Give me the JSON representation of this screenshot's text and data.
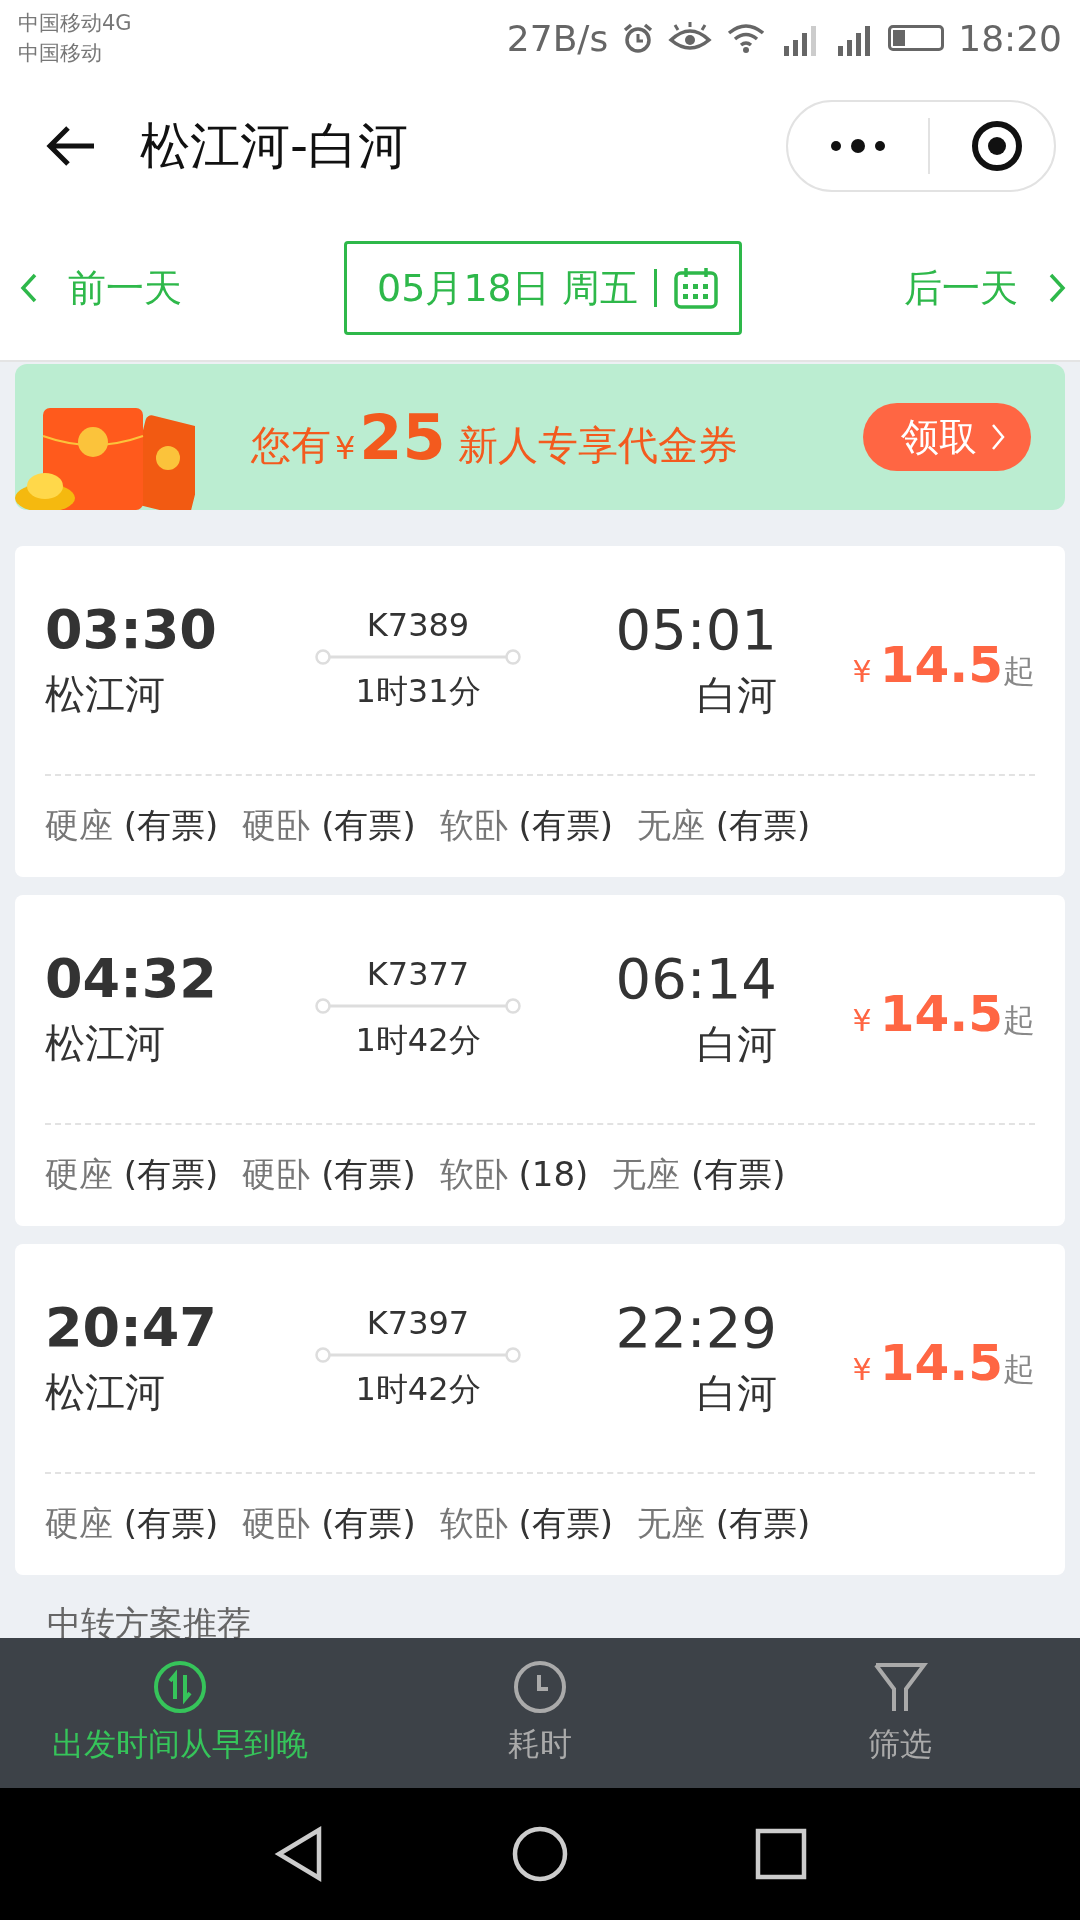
{
  "status_bar": {
    "carrier_1": "中国移动4G",
    "carrier_2": "中国移动",
    "speed": "27B/s",
    "time": "18:20"
  },
  "header": {
    "title": "松江河-白河"
  },
  "date_bar": {
    "prev": "前一天",
    "date": "05月18日 周五",
    "next": "后一天"
  },
  "banner": {
    "prefix": "您有",
    "currency": "¥",
    "amount": "25",
    "suffix": "新人专享代金券",
    "button": "领取"
  },
  "trains": [
    {
      "depart": "03:30",
      "from": "松江河",
      "number": "K7389",
      "duration": "1时31分",
      "arrive": "05:01",
      "to": "白河",
      "currency": "¥",
      "price": "14.5",
      "price_suffix": "起",
      "seats": [
        {
          "type": "硬座",
          "status": "(有票)"
        },
        {
          "type": "硬卧",
          "status": "(有票)"
        },
        {
          "type": "软卧",
          "status": "(有票)"
        },
        {
          "type": "无座",
          "status": "(有票)"
        }
      ]
    },
    {
      "depart": "04:32",
      "from": "松江河",
      "number": "K7377",
      "duration": "1时42分",
      "arrive": "06:14",
      "to": "白河",
      "currency": "¥",
      "price": "14.5",
      "price_suffix": "起",
      "seats": [
        {
          "type": "硬座",
          "status": "(有票)"
        },
        {
          "type": "硬卧",
          "status": "(有票)"
        },
        {
          "type": "软卧",
          "status": "(18)"
        },
        {
          "type": "无座",
          "status": "(有票)"
        }
      ]
    },
    {
      "depart": "20:47",
      "from": "松江河",
      "number": "K7397",
      "duration": "1时42分",
      "arrive": "22:29",
      "to": "白河",
      "currency": "¥",
      "price": "14.5",
      "price_suffix": "起",
      "seats": [
        {
          "type": "硬座",
          "status": "(有票)"
        },
        {
          "type": "硬卧",
          "status": "(有票)"
        },
        {
          "type": "软卧",
          "status": "(有票)"
        },
        {
          "type": "无座",
          "status": "(有票)"
        }
      ]
    }
  ],
  "transfer": {
    "heading": "中转方案推荐"
  },
  "bottom_tabs": [
    {
      "label": "出发时间从早到晚",
      "kind": "sort",
      "selected": true
    },
    {
      "label": "耗时",
      "kind": "clock",
      "selected": false
    },
    {
      "label": "筛选",
      "kind": "filter",
      "selected": false
    }
  ]
}
